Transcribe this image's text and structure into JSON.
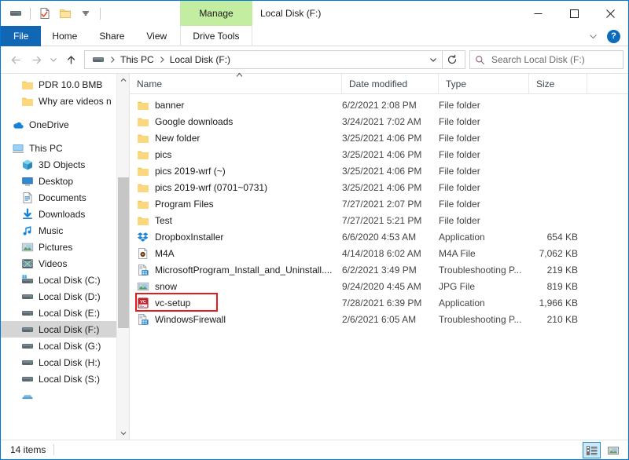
{
  "window": {
    "title": "Local Disk (F:)",
    "contextual_group_label": "Manage",
    "minimize_icon": "minimize-icon",
    "maximize_icon": "maximize-icon",
    "close_icon": "close-icon"
  },
  "quick_access": {
    "items": [
      {
        "name": "drive-icon",
        "label": "Local Disk properties"
      },
      {
        "name": "properties-icon",
        "label": "Properties"
      },
      {
        "name": "new-folder-icon",
        "label": "New folder"
      },
      {
        "name": "chevron-down-icon",
        "label": "Customize Quick Access Toolbar"
      }
    ]
  },
  "ribbon": {
    "tabs": [
      {
        "label": "File",
        "active": true
      },
      {
        "label": "Home",
        "active": false
      },
      {
        "label": "Share",
        "active": false
      },
      {
        "label": "View",
        "active": false
      }
    ],
    "contextual_tab": "Drive Tools",
    "collapse_icon": "chevron-down-icon",
    "help_label": "?"
  },
  "navigation": {
    "back_icon": "arrow-left-icon",
    "forward_icon": "arrow-right-icon",
    "recent_icon": "chevron-down-icon",
    "up_icon": "arrow-up-icon",
    "breadcrumb": {
      "root_icon": "drive-icon",
      "parts": [
        "This PC",
        "Local Disk (F:)"
      ],
      "dropdown_icon": "chevron-down-icon"
    },
    "refresh_icon": "refresh-icon",
    "search": {
      "icon": "search-icon",
      "placeholder": "Search Local Disk (F:)",
      "value": ""
    }
  },
  "sidebar": {
    "items": [
      {
        "label": "PDR 10.0 BMB",
        "icon": "folder-icon",
        "indent": 1,
        "selected": false
      },
      {
        "label": "Why are videos n",
        "icon": "folder-icon",
        "indent": 1,
        "selected": false
      },
      {
        "label": "OneDrive",
        "icon": "onedrive-icon",
        "indent": 0,
        "selected": false,
        "gap_before": true
      },
      {
        "label": "This PC",
        "icon": "this-pc-icon",
        "indent": 0,
        "selected": false,
        "gap_before": true
      },
      {
        "label": "3D Objects",
        "icon": "3d-objects-icon",
        "indent": 1,
        "selected": false
      },
      {
        "label": "Desktop",
        "icon": "desktop-icon",
        "indent": 1,
        "selected": false
      },
      {
        "label": "Documents",
        "icon": "documents-icon",
        "indent": 1,
        "selected": false
      },
      {
        "label": "Downloads",
        "icon": "downloads-icon",
        "indent": 1,
        "selected": false
      },
      {
        "label": "Music",
        "icon": "music-icon",
        "indent": 1,
        "selected": false
      },
      {
        "label": "Pictures",
        "icon": "pictures-icon",
        "indent": 1,
        "selected": false
      },
      {
        "label": "Videos",
        "icon": "videos-icon",
        "indent": 1,
        "selected": false
      },
      {
        "label": "Local Disk (C:)",
        "icon": "system-drive-icon",
        "indent": 1,
        "selected": false
      },
      {
        "label": "Local Disk (D:)",
        "icon": "drive-icon",
        "indent": 1,
        "selected": false
      },
      {
        "label": "Local Disk (E:)",
        "icon": "drive-icon",
        "indent": 1,
        "selected": false
      },
      {
        "label": "Local Disk (F:)",
        "icon": "drive-icon",
        "indent": 1,
        "selected": true
      },
      {
        "label": "Local Disk (G:)",
        "icon": "drive-icon",
        "indent": 1,
        "selected": false
      },
      {
        "label": "Local Disk (H:)",
        "icon": "drive-icon",
        "indent": 1,
        "selected": false
      },
      {
        "label": "Local Disk (S:)",
        "icon": "drive-icon",
        "indent": 1,
        "selected": false
      },
      {
        "label": "",
        "icon": "network-icon",
        "indent": 1,
        "selected": false
      }
    ],
    "scrollbar": {
      "up_icon": "chevron-up-icon",
      "down_icon": "chevron-down-icon"
    }
  },
  "filelist": {
    "columns": [
      {
        "key": "name",
        "label": "Name",
        "sorted": "asc"
      },
      {
        "key": "date",
        "label": "Date modified"
      },
      {
        "key": "type",
        "label": "Type"
      },
      {
        "key": "size",
        "label": "Size"
      }
    ],
    "sort_caret": "▲",
    "rows": [
      {
        "name": "banner",
        "date": "6/2/2021 2:08 PM",
        "type": "File folder",
        "size": "",
        "icon": "folder-icon"
      },
      {
        "name": "Google downloads",
        "date": "3/24/2021 7:02 AM",
        "type": "File folder",
        "size": "",
        "icon": "folder-icon"
      },
      {
        "name": "New folder",
        "date": "3/25/2021 4:06 PM",
        "type": "File folder",
        "size": "",
        "icon": "folder-icon"
      },
      {
        "name": "pics",
        "date": "3/25/2021 4:06 PM",
        "type": "File folder",
        "size": "",
        "icon": "folder-icon"
      },
      {
        "name": "pics 2019-wrf (~)",
        "date": "3/25/2021 4:06 PM",
        "type": "File folder",
        "size": "",
        "icon": "folder-icon"
      },
      {
        "name": "pics 2019-wrf (0701~0731)",
        "date": "3/25/2021 4:06 PM",
        "type": "File folder",
        "size": "",
        "icon": "folder-icon"
      },
      {
        "name": "Program Files",
        "date": "7/27/2021 2:07 PM",
        "type": "File folder",
        "size": "",
        "icon": "folder-icon"
      },
      {
        "name": "Test",
        "date": "7/27/2021 5:21 PM",
        "type": "File folder",
        "size": "",
        "icon": "folder-icon"
      },
      {
        "name": "DropboxInstaller",
        "date": "6/6/2020 4:53 AM",
        "type": "Application",
        "size": "654 KB",
        "icon": "dropbox-icon"
      },
      {
        "name": "M4A",
        "date": "4/14/2018 6:02 AM",
        "type": "M4A File",
        "size": "7,062 KB",
        "icon": "media-file-icon"
      },
      {
        "name": "MicrosoftProgram_Install_and_Uninstall....",
        "date": "6/2/2021 3:49 PM",
        "type": "Troubleshooting P...",
        "size": "219 KB",
        "icon": "troubleshooter-icon"
      },
      {
        "name": "snow",
        "date": "9/24/2020 4:45 AM",
        "type": "JPG File",
        "size": "819 KB",
        "icon": "image-file-icon"
      },
      {
        "name": "vc-setup",
        "date": "7/28/2021 6:39 PM",
        "type": "Application",
        "size": "1,966 KB",
        "icon": "vc-setup-icon",
        "annotated": true
      },
      {
        "name": "WindowsFirewall",
        "date": "2/6/2021 6:05 AM",
        "type": "Troubleshooting P...",
        "size": "210 KB",
        "icon": "troubleshooter-icon"
      }
    ]
  },
  "statusbar": {
    "item_count": "14 items",
    "views": [
      {
        "name": "details-view-button",
        "selected": true
      },
      {
        "name": "large-icons-view-button",
        "selected": false
      }
    ]
  },
  "colors": {
    "accent_blue": "#0078d7",
    "file_tab_blue": "#1267b5",
    "contextual_green": "#c3eda0",
    "annotation_red": "#e51c1c",
    "selection_grey": "#d5d5d5"
  }
}
